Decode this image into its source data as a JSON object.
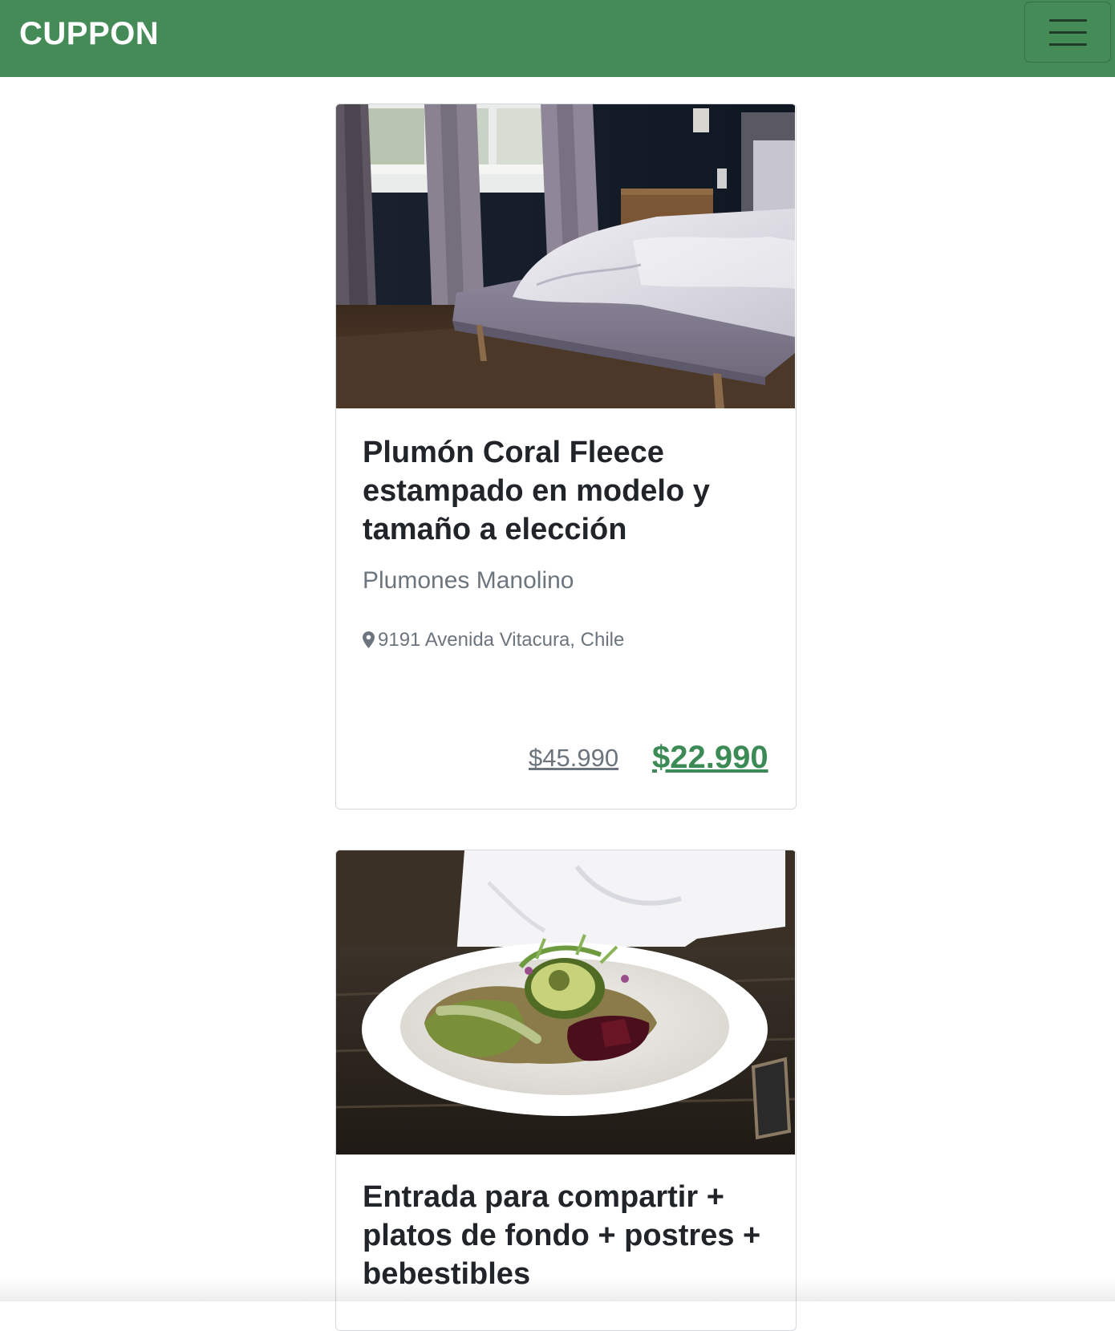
{
  "navbar": {
    "brand": "CUPPON",
    "menu_icon": "hamburger-menu-icon",
    "background_color": "#448b57"
  },
  "deals": [
    {
      "image_icon": "bedroom-photo",
      "title": "Plumón Coral Fleece estampado en modelo y tamaño a elección",
      "merchant": "Plumones Manolino",
      "location_icon": "map-marker-icon",
      "location": "9191 Avenida Vitacura, Chile",
      "original_price": "$45.990",
      "sale_price": "$22.990"
    },
    {
      "image_icon": "salad-bowl-photo",
      "title": "Entrada para compartir + platos de fondo + postres + bebestibles"
    }
  ],
  "colors": {
    "accent": "#448b57",
    "sale_price": "#3c8a55",
    "muted_text": "#6c757d"
  }
}
